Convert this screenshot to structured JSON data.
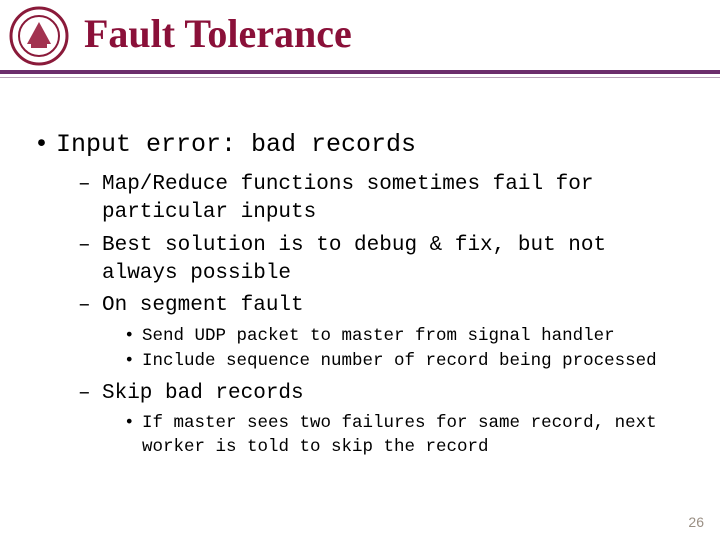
{
  "slide": {
    "title": "Fault Tolerance",
    "page_number": "26",
    "lvl1": "Input error: bad records",
    "lvl2": [
      "Map/Reduce functions sometimes fail for particular inputs",
      "Best solution is to debug & fix, but not always possible",
      "On segment fault",
      "Skip bad records"
    ],
    "lvl3_a": [
      "Send UDP packet to master from signal handler",
      "Include sequence number of record being processed"
    ],
    "lvl3_b": [
      "If master sees two failures for same record, next worker is told to skip the record"
    ]
  },
  "colors": {
    "title": "#8a1039",
    "rule": "#6b2d6b"
  }
}
